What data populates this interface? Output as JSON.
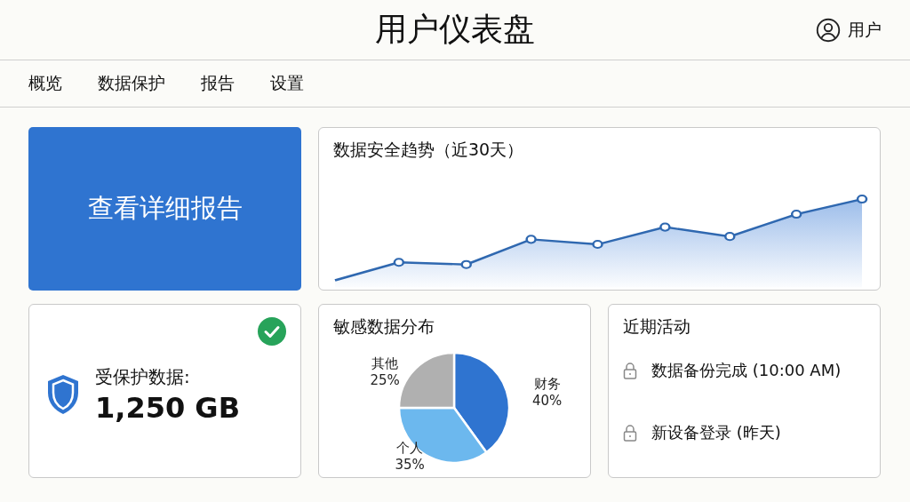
{
  "header": {
    "title": "用户仪表盘",
    "user": "用户"
  },
  "nav": [
    {
      "label": "概览",
      "selected": false
    },
    {
      "label": "数据保护",
      "selected": false
    },
    {
      "label": "报告",
      "selected": false
    },
    {
      "label": "设置",
      "selected": false
    }
  ],
  "report_button": "查看详细报告",
  "trend": {
    "title": "数据安全趋势（近30天）"
  },
  "protected": {
    "label": "受保护数据:",
    "value": "1,250 GB",
    "verified": true
  },
  "distribution": {
    "title": "敏感数据分布",
    "chart_data": {
      "type": "pie",
      "categories": [
        "财务",
        "个人",
        "其他"
      ],
      "values": [
        40,
        35,
        25
      ],
      "colors": [
        "#2f74d0",
        "#6cb8ee",
        "#b0b0b0"
      ],
      "value_labels": [
        "40%",
        "35%",
        "25%"
      ]
    }
  },
  "activity": {
    "title": "近期活动",
    "items": [
      {
        "text": "数据备份完成 (10:00 AM)"
      },
      {
        "text": "新设备登录 (昨天)"
      }
    ]
  }
}
